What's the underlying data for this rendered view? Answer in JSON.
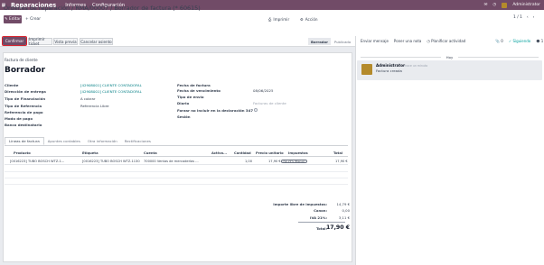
{
  "topbar": {
    "app_name": "Reparaciones",
    "menus": [
      "Informes",
      "Configuración"
    ],
    "user": "Administrator",
    "bg": "#714b67"
  },
  "breadcrumb": {
    "parent": "Órdenes de reparación",
    "order": "RMA/00007",
    "current": "Borrador de factura (* 60615)"
  },
  "toolbar": {
    "edit_label": "Editar",
    "create_label": "Crear",
    "print_label": "Imprimir",
    "action_label": "Acción",
    "pager": "1 / 1"
  },
  "statusbar": {
    "confirm_label": "Confirmar",
    "print_ticket_label": "Imprimir ticket",
    "preview_label": "Vista previa",
    "cancel_label": "Cancelar asiento",
    "states": [
      "Borrador",
      "Publicado"
    ],
    "active_state": "Borrador"
  },
  "invoice": {
    "type_label": "Factura de cliente",
    "status_title": "Borrador",
    "left_fields": [
      {
        "label": "Cliente",
        "value": "[42908001] CLIENTE CONTADOFAL"
      },
      {
        "label": "Dirección de entrega",
        "value": "[42908001] CLIENTE CONTADOFAL"
      },
      {
        "label": "Tipo de Financiación",
        "value": "A cobrar"
      },
      {
        "label": "Tipo de Referencia",
        "value": "Referencia Libre"
      },
      {
        "label": "Referencia de pago",
        "value": ""
      },
      {
        "label": "Modo de pago",
        "value": ""
      },
      {
        "label": "Banco destinatario",
        "value": ""
      }
    ],
    "right_fields": [
      {
        "label": "Fecha de factura",
        "value": ""
      },
      {
        "label": "Fecha de vencimiento",
        "value": "08/06/2025"
      },
      {
        "label": "Tipo de envío",
        "value": ""
      },
      {
        "label": "Diario",
        "value": "Facturas de cliente"
      },
      {
        "label": "Forzar no incluir en la declaración 347",
        "value": ""
      },
      {
        "label": "Sesión",
        "value": ""
      }
    ]
  },
  "tabs": [
    "Líneas de factura",
    "Apuntes contables",
    "Otra información",
    "Rectificaciones"
  ],
  "lines_table": {
    "columns": [
      "Producto",
      "Etiqueta",
      "Cuenta",
      "Activo...",
      "Cantidad",
      "Precio unitario",
      "Impuestos",
      "Total"
    ],
    "rows": [
      {
        "producto": "[0016223] TUBO BOSCH WTZ-1...",
        "etiqueta": "[0016223] TUBO BOSCH WTZ-1130",
        "cuenta": "700000 Ventas de mercaderías ...",
        "activo": "",
        "cantidad": "1,00",
        "precio": "17,90 €",
        "impuestos": "IVA 21% (Bienes)",
        "total": "17,90 €"
      }
    ]
  },
  "totals": {
    "base_label": "Importe libre de impuestos:",
    "base_value": "14,79 €",
    "canon_label": "Canon:",
    "canon_value": "0,00",
    "iva_label": "IVA 21%:",
    "iva_value": "3,11 €",
    "total_label": "Total:",
    "total_value": "17,90 €"
  },
  "chatter": {
    "send_message": "Enviar mensaje",
    "log_note": "Poner una nota",
    "schedule": "Planificar actividad",
    "attachments": "0",
    "following": "Siguiendo",
    "followers": "1",
    "day_label": "Hoy",
    "message": {
      "author": "Administrator",
      "time": "- hace un minuto",
      "body": "Factura creada"
    }
  }
}
